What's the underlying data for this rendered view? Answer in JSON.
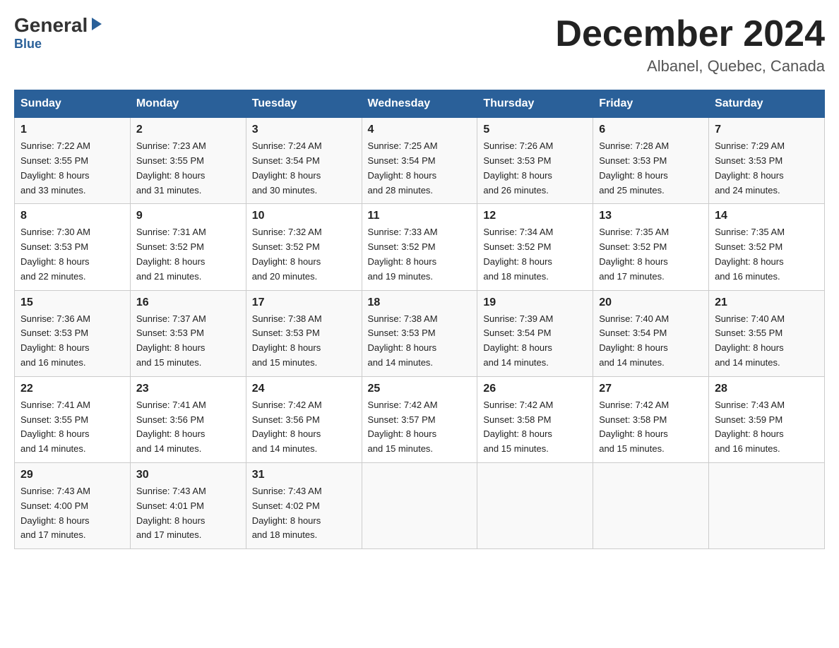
{
  "header": {
    "logo_general": "General",
    "logo_blue": "Blue",
    "month_title": "December 2024",
    "location": "Albanel, Quebec, Canada"
  },
  "days_of_week": [
    "Sunday",
    "Monday",
    "Tuesday",
    "Wednesday",
    "Thursday",
    "Friday",
    "Saturday"
  ],
  "weeks": [
    [
      {
        "day": "1",
        "sunrise": "7:22 AM",
        "sunset": "3:55 PM",
        "daylight": "8 hours and 33 minutes."
      },
      {
        "day": "2",
        "sunrise": "7:23 AM",
        "sunset": "3:55 PM",
        "daylight": "8 hours and 31 minutes."
      },
      {
        "day": "3",
        "sunrise": "7:24 AM",
        "sunset": "3:54 PM",
        "daylight": "8 hours and 30 minutes."
      },
      {
        "day": "4",
        "sunrise": "7:25 AM",
        "sunset": "3:54 PM",
        "daylight": "8 hours and 28 minutes."
      },
      {
        "day": "5",
        "sunrise": "7:26 AM",
        "sunset": "3:53 PM",
        "daylight": "8 hours and 26 minutes."
      },
      {
        "day": "6",
        "sunrise": "7:28 AM",
        "sunset": "3:53 PM",
        "daylight": "8 hours and 25 minutes."
      },
      {
        "day": "7",
        "sunrise": "7:29 AM",
        "sunset": "3:53 PM",
        "daylight": "8 hours and 24 minutes."
      }
    ],
    [
      {
        "day": "8",
        "sunrise": "7:30 AM",
        "sunset": "3:53 PM",
        "daylight": "8 hours and 22 minutes."
      },
      {
        "day": "9",
        "sunrise": "7:31 AM",
        "sunset": "3:52 PM",
        "daylight": "8 hours and 21 minutes."
      },
      {
        "day": "10",
        "sunrise": "7:32 AM",
        "sunset": "3:52 PM",
        "daylight": "8 hours and 20 minutes."
      },
      {
        "day": "11",
        "sunrise": "7:33 AM",
        "sunset": "3:52 PM",
        "daylight": "8 hours and 19 minutes."
      },
      {
        "day": "12",
        "sunrise": "7:34 AM",
        "sunset": "3:52 PM",
        "daylight": "8 hours and 18 minutes."
      },
      {
        "day": "13",
        "sunrise": "7:35 AM",
        "sunset": "3:52 PM",
        "daylight": "8 hours and 17 minutes."
      },
      {
        "day": "14",
        "sunrise": "7:35 AM",
        "sunset": "3:52 PM",
        "daylight": "8 hours and 16 minutes."
      }
    ],
    [
      {
        "day": "15",
        "sunrise": "7:36 AM",
        "sunset": "3:53 PM",
        "daylight": "8 hours and 16 minutes."
      },
      {
        "day": "16",
        "sunrise": "7:37 AM",
        "sunset": "3:53 PM",
        "daylight": "8 hours and 15 minutes."
      },
      {
        "day": "17",
        "sunrise": "7:38 AM",
        "sunset": "3:53 PM",
        "daylight": "8 hours and 15 minutes."
      },
      {
        "day": "18",
        "sunrise": "7:38 AM",
        "sunset": "3:53 PM",
        "daylight": "8 hours and 14 minutes."
      },
      {
        "day": "19",
        "sunrise": "7:39 AM",
        "sunset": "3:54 PM",
        "daylight": "8 hours and 14 minutes."
      },
      {
        "day": "20",
        "sunrise": "7:40 AM",
        "sunset": "3:54 PM",
        "daylight": "8 hours and 14 minutes."
      },
      {
        "day": "21",
        "sunrise": "7:40 AM",
        "sunset": "3:55 PM",
        "daylight": "8 hours and 14 minutes."
      }
    ],
    [
      {
        "day": "22",
        "sunrise": "7:41 AM",
        "sunset": "3:55 PM",
        "daylight": "8 hours and 14 minutes."
      },
      {
        "day": "23",
        "sunrise": "7:41 AM",
        "sunset": "3:56 PM",
        "daylight": "8 hours and 14 minutes."
      },
      {
        "day": "24",
        "sunrise": "7:42 AM",
        "sunset": "3:56 PM",
        "daylight": "8 hours and 14 minutes."
      },
      {
        "day": "25",
        "sunrise": "7:42 AM",
        "sunset": "3:57 PM",
        "daylight": "8 hours and 15 minutes."
      },
      {
        "day": "26",
        "sunrise": "7:42 AM",
        "sunset": "3:58 PM",
        "daylight": "8 hours and 15 minutes."
      },
      {
        "day": "27",
        "sunrise": "7:42 AM",
        "sunset": "3:58 PM",
        "daylight": "8 hours and 15 minutes."
      },
      {
        "day": "28",
        "sunrise": "7:43 AM",
        "sunset": "3:59 PM",
        "daylight": "8 hours and 16 minutes."
      }
    ],
    [
      {
        "day": "29",
        "sunrise": "7:43 AM",
        "sunset": "4:00 PM",
        "daylight": "8 hours and 17 minutes."
      },
      {
        "day": "30",
        "sunrise": "7:43 AM",
        "sunset": "4:01 PM",
        "daylight": "8 hours and 17 minutes."
      },
      {
        "day": "31",
        "sunrise": "7:43 AM",
        "sunset": "4:02 PM",
        "daylight": "8 hours and 18 minutes."
      },
      null,
      null,
      null,
      null
    ]
  ],
  "labels": {
    "sunrise": "Sunrise:",
    "sunset": "Sunset:",
    "daylight": "Daylight:"
  }
}
